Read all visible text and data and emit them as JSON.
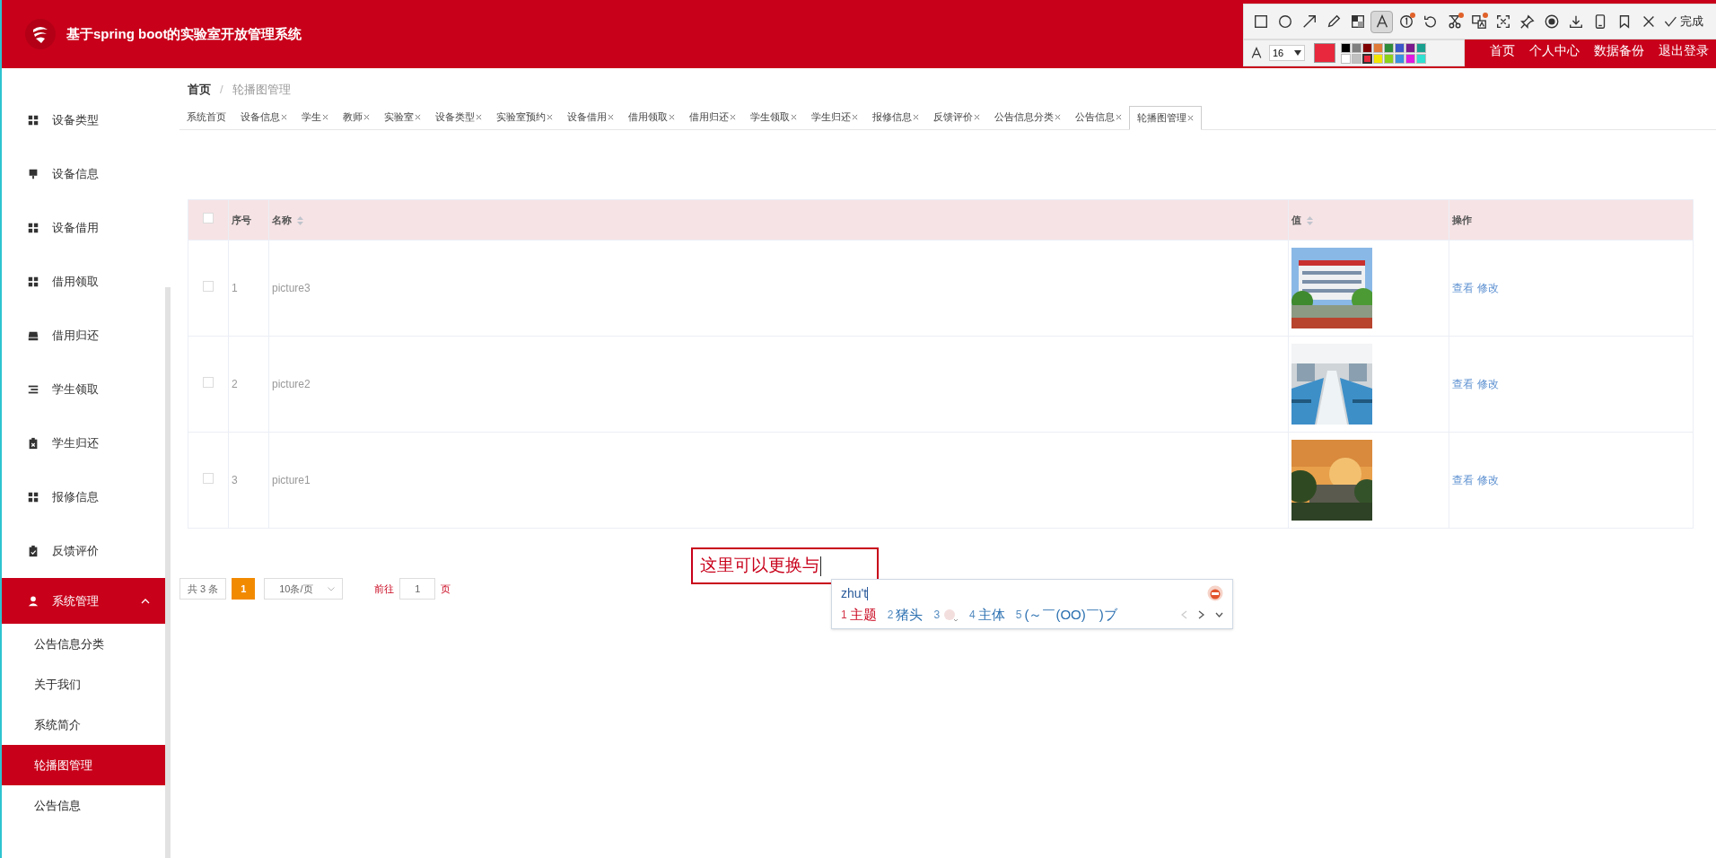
{
  "header": {
    "title": "基于spring boot的实验室开放管理系统",
    "nav": [
      "首页",
      "个人中心",
      "数据备份",
      "退出登录"
    ]
  },
  "annotation_toolbar": {
    "tools": [
      {
        "kind": "rectangle",
        "selected": false,
        "dot": false
      },
      {
        "kind": "ellipse",
        "selected": false,
        "dot": false
      },
      {
        "kind": "arrow",
        "selected": false,
        "dot": false
      },
      {
        "kind": "pen",
        "selected": false,
        "dot": false
      },
      {
        "kind": "mosaic",
        "selected": false,
        "dot": false
      },
      {
        "kind": "text",
        "selected": true,
        "dot": false
      },
      {
        "kind": "number",
        "selected": false,
        "dot": true
      },
      {
        "kind": "undo",
        "selected": false,
        "dot": false
      },
      {
        "kind": "cut",
        "selected": false,
        "dot": true
      },
      {
        "kind": "translate",
        "selected": false,
        "dot": true
      },
      {
        "kind": "scan",
        "selected": false,
        "dot": false
      },
      {
        "kind": "pin",
        "selected": false,
        "dot": false
      },
      {
        "kind": "record",
        "selected": false,
        "dot": false
      },
      {
        "kind": "download",
        "selected": false,
        "dot": false
      },
      {
        "kind": "phone",
        "selected": false,
        "dot": false
      },
      {
        "kind": "bookmark",
        "selected": false,
        "dot": false
      },
      {
        "kind": "close",
        "selected": false,
        "dot": false
      }
    ],
    "done": "完成",
    "font_size": "16",
    "colors": [
      {
        "color": "#000000",
        "selected": false
      },
      {
        "color": "#808080",
        "selected": false
      },
      {
        "color": "#800000",
        "selected": false
      },
      {
        "color": "#e07b39",
        "selected": false
      },
      {
        "color": "#2e8b3a",
        "selected": false
      },
      {
        "color": "#3a56c9",
        "selected": false
      },
      {
        "color": "#7a1a8c",
        "selected": false
      },
      {
        "color": "#1aa08f",
        "selected": false
      },
      {
        "color": "#ffffff",
        "selected": false
      },
      {
        "color": "#c0c0c0",
        "selected": false
      },
      {
        "color": "#e8283c",
        "selected": true
      },
      {
        "color": "#f2e600",
        "selected": false
      },
      {
        "color": "#8cd11a",
        "selected": false
      },
      {
        "color": "#3a8fe0",
        "selected": false
      },
      {
        "color": "#e01ae0",
        "selected": false
      },
      {
        "color": "#30e0d0",
        "selected": false
      }
    ]
  },
  "sidebar": {
    "items": [
      {
        "label": "设备类型",
        "kind": "grid"
      },
      {
        "label": "设备信息",
        "kind": "stamp"
      },
      {
        "label": "设备借用",
        "kind": "grid"
      },
      {
        "label": "借用领取",
        "kind": "grid"
      },
      {
        "label": "借用归还",
        "kind": "tray"
      },
      {
        "label": "学生领取",
        "kind": "list"
      },
      {
        "label": "学生归还",
        "kind": "clipboard-x"
      },
      {
        "label": "报修信息",
        "kind": "grid"
      },
      {
        "label": "反馈评价",
        "kind": "clipboard-check"
      }
    ],
    "group": {
      "label": "系统管理",
      "expanded": true,
      "children": [
        {
          "label": "公告信息分类",
          "selected": false
        },
        {
          "label": "关于我们",
          "selected": false
        },
        {
          "label": "系统简介",
          "selected": false
        },
        {
          "label": "轮播图管理",
          "selected": true
        },
        {
          "label": "公告信息",
          "selected": false
        }
      ]
    }
  },
  "breadcrumb": {
    "separator": "/",
    "items": [
      "首页",
      "轮播图管理"
    ]
  },
  "tabs": [
    {
      "label": "系统首页",
      "closable": false,
      "selected": false
    },
    {
      "label": "设备信息",
      "closable": true,
      "selected": false
    },
    {
      "label": "学生",
      "closable": true,
      "selected": false
    },
    {
      "label": "教师",
      "closable": true,
      "selected": false
    },
    {
      "label": "实验室",
      "closable": true,
      "selected": false
    },
    {
      "label": "设备类型",
      "closable": true,
      "selected": false
    },
    {
      "label": "实验室预约",
      "closable": true,
      "selected": false
    },
    {
      "label": "设备借用",
      "closable": true,
      "selected": false
    },
    {
      "label": "借用领取",
      "closable": true,
      "selected": false
    },
    {
      "label": "借用归还",
      "closable": true,
      "selected": false
    },
    {
      "label": "学生领取",
      "closable": true,
      "selected": false
    },
    {
      "label": "学生归还",
      "closable": true,
      "selected": false
    },
    {
      "label": "报修信息",
      "closable": true,
      "selected": false
    },
    {
      "label": "反馈评价",
      "closable": true,
      "selected": false
    },
    {
      "label": "公告信息分类",
      "closable": true,
      "selected": false
    },
    {
      "label": "公告信息",
      "closable": true,
      "selected": false
    },
    {
      "label": "轮播图管理",
      "closable": true,
      "selected": true
    }
  ],
  "table": {
    "all_checked": false,
    "columns": [
      {
        "label": "序号",
        "sortable": false
      },
      {
        "label": "名称",
        "sortable": true
      },
      {
        "label": "值",
        "sortable": true
      },
      {
        "label": "操作",
        "sortable": false
      }
    ],
    "rows": [
      {
        "checked": false,
        "index": "1",
        "name": "picture3",
        "value": {
          "kind": "picture"
        },
        "actions": [
          "查看",
          "修改"
        ]
      },
      {
        "checked": false,
        "index": "2",
        "name": "picture2",
        "value": {
          "kind": "picture"
        },
        "actions": [
          "查看",
          "修改"
        ]
      },
      {
        "checked": false,
        "index": "3",
        "name": "picture1",
        "value": {
          "kind": "picture"
        },
        "actions": [
          "查看",
          "修改"
        ]
      }
    ]
  },
  "pagination": {
    "total": "共 3 条",
    "pages": [
      {
        "label": "1",
        "selected": true
      }
    ],
    "page_size": "10条/页",
    "goto_label": "前往",
    "goto_value": "1",
    "page_unit": "页"
  },
  "annotation": {
    "text": "这里可以更换与"
  },
  "ime": {
    "input": "zhu't",
    "candidates": [
      {
        "number": "1",
        "text": "主题",
        "selected": true,
        "kind": "text"
      },
      {
        "number": "2",
        "text": "猪头",
        "selected": false,
        "kind": "text"
      },
      {
        "number": "3",
        "selected": false,
        "kind": "emoji"
      },
      {
        "number": "4",
        "text": "主体",
        "selected": false,
        "kind": "text"
      },
      {
        "number": "5",
        "text": "(～￣(OO)￣)ブ",
        "selected": false,
        "kind": "text"
      }
    ]
  }
}
